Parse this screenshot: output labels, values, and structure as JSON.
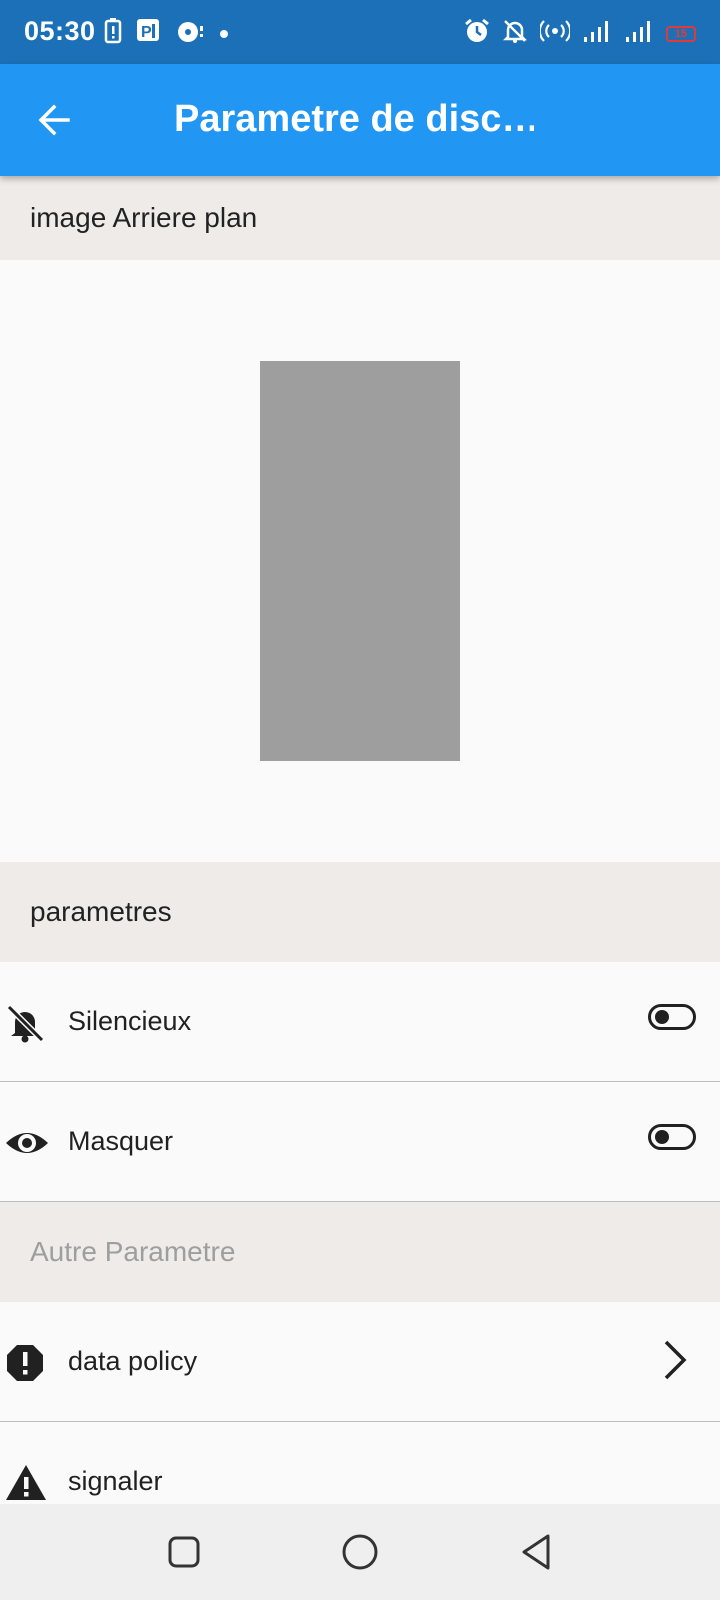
{
  "status_bar": {
    "time": "05:30",
    "battery_level": "15",
    "left_icons": [
      "battery-alert-icon",
      "parking-app-icon",
      "sync-app-icon",
      "notification-dot-icon"
    ],
    "right_icons": [
      "alarm-icon",
      "bell-off-icon",
      "hotspot-icon",
      "signal-icon",
      "signal-icon",
      "battery-icon"
    ],
    "background": "#1b70b8"
  },
  "app_bar": {
    "title": "Parametre de disc…",
    "back_icon": "arrow-back-icon",
    "background": "#2196f3"
  },
  "sections": {
    "background_image": {
      "title": "image Arriere plan"
    },
    "settings": {
      "title": "parametres"
    },
    "other": {
      "title": "Autre Parametre"
    }
  },
  "settings_items": [
    {
      "label": "Silencieux",
      "icon": "bell-off-icon",
      "toggle_on": false
    },
    {
      "label": "Masquer",
      "icon": "eye-icon",
      "toggle_on": false
    }
  ],
  "other_items": [
    {
      "label": "data policy",
      "icon": "alert-octagon-icon",
      "trailing": "chevron-right-icon"
    },
    {
      "label": "signaler",
      "icon": "warning-triangle-icon"
    }
  ],
  "nav_bar": {
    "buttons": [
      "recents-square-icon",
      "home-circle-icon",
      "back-triangle-icon"
    ]
  },
  "colors": {
    "section_header_bg": "#efebe9",
    "placeholder_gray": "#9e9e9e"
  }
}
